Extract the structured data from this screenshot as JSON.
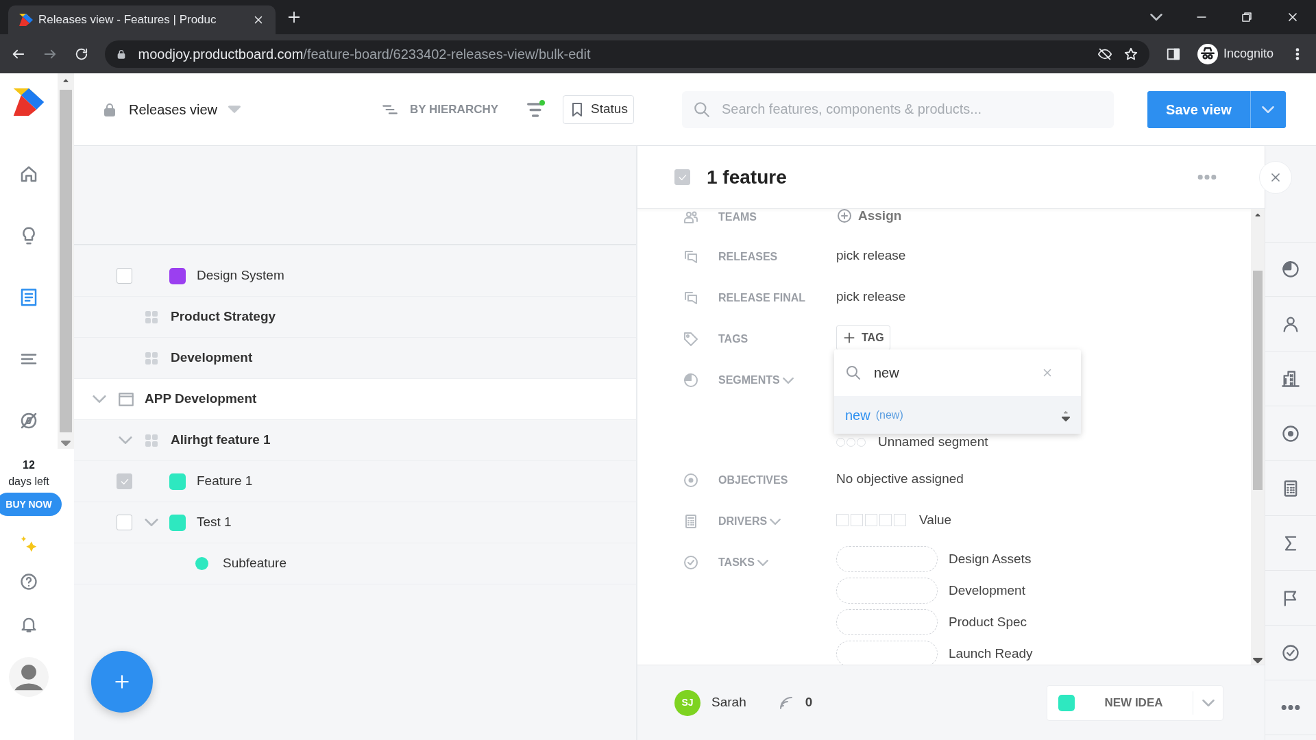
{
  "browser": {
    "tab_title": "Releases view - Features | Produc",
    "url_host": "moodjoy.productboard.com",
    "url_path": "/feature-board/6233402-releases-view/bulk-edit",
    "profile": "Incognito"
  },
  "nav": {
    "items": [
      {
        "selected": false
      },
      {
        "selected": false
      },
      {
        "selected": true
      },
      {
        "selected": false
      },
      {
        "selected": false
      }
    ],
    "trial_days": "12",
    "trial_text": "days left",
    "buy_button": "BUY NOW"
  },
  "header": {
    "view_name": "Releases view",
    "grouping": "BY HIERARCHY",
    "status_button": "Status",
    "search": {
      "placeholder": "Search features, components & products..."
    },
    "save_button": "Save view"
  },
  "tree": [
    {
      "kind": "feature",
      "label": "Design System",
      "checked": false,
      "color": "#9b3ff0"
    },
    {
      "kind": "component",
      "label": "Product Strategy"
    },
    {
      "kind": "component",
      "label": "Development"
    },
    {
      "kind": "product",
      "label": "APP Development",
      "expanded": true,
      "children": [
        {
          "kind": "component",
          "label": "Alirhgt feature 1",
          "expanded": true,
          "children": [
            {
              "kind": "feature",
              "label": "Feature 1",
              "checked": true,
              "color": "#2ee8c0"
            },
            {
              "kind": "feature",
              "label": "Test 1",
              "checked": false,
              "expanded": true,
              "color": "#2ee8c0",
              "children": [
                {
                  "kind": "subfeature",
                  "label": "Subfeature",
                  "color": "#2ee8c0"
                }
              ]
            }
          ]
        }
      ]
    }
  ],
  "detail": {
    "title": "1 feature",
    "checked": true,
    "fields": [
      {
        "kind": "teams",
        "label": "TEAMS",
        "value": "Assign"
      },
      {
        "kind": "releases",
        "label": "RELEASES",
        "value": "pick release"
      },
      {
        "kind": "releases",
        "label": "RELEASE FINAL",
        "value": "pick release"
      },
      {
        "kind": "tags",
        "label": "TAGS",
        "value": "TAG"
      },
      {
        "kind": "segments",
        "label": "SEGMENTS",
        "value": "Unnamed segment"
      },
      {
        "kind": "objectives",
        "label": "OBJECTIVES",
        "value": "No objective assigned"
      },
      {
        "kind": "drivers",
        "label": "DRIVERS",
        "value": "Value"
      },
      {
        "kind": "tasks",
        "label": "TASKS",
        "items": [
          "Design Assets",
          "Development",
          "Product Spec",
          "Launch Ready"
        ]
      }
    ],
    "tag_menu": {
      "query": "new",
      "option": "new",
      "option_note": "(new)"
    },
    "footer": {
      "initials": "SJ",
      "user": "Sarah",
      "votes": "0",
      "status": {
        "label": "NEW IDEA",
        "color": "#2ee8c0"
      }
    }
  }
}
